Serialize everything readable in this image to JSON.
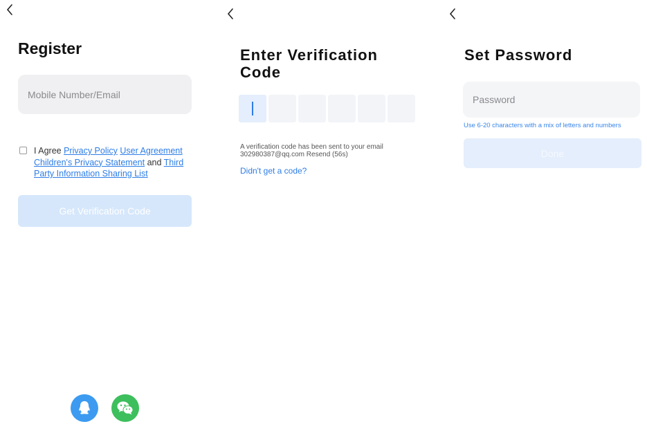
{
  "register": {
    "title": "Register",
    "account_placeholder": "Mobile Number/Email",
    "agree_prefix": "I Agree ",
    "links": {
      "privacy_policy": "Privacy Policy",
      "user_agreement": "User Agreement",
      "childrens_privacy": "Children's Privacy Statement",
      "and": " and ",
      "third_party": "Third Party Information Sharing List"
    },
    "submit_label": "Get Verification Code"
  },
  "verify": {
    "title": "Enter Verification Code",
    "sent_text": "A verification code has been sent to your email",
    "email": "302980387@qq.com",
    "resend_label": "Resend (56s)",
    "no_code_label": "Didn't get a code?"
  },
  "password": {
    "title": "Set Password",
    "password_placeholder": "Password",
    "hint": "Use 6-20 characters with a mix of letters and numbers",
    "submit_label": "Done"
  },
  "colors": {
    "accent": "#2d7de6",
    "button_disabled": "#d6e7fb",
    "qq": "#3c9bf0",
    "wechat": "#3cbf5c"
  }
}
